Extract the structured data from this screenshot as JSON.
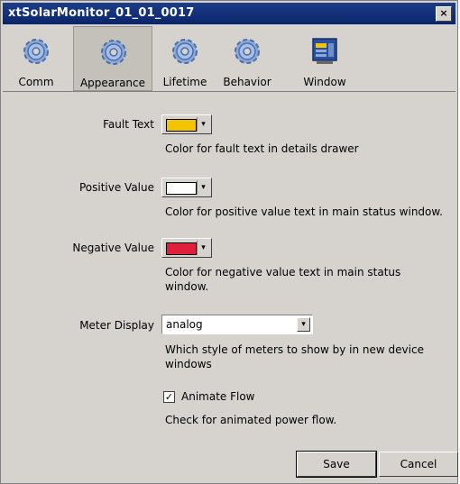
{
  "window": {
    "title": "xtSolarMonitor_01_01_0017",
    "close": "×"
  },
  "toolbar": {
    "items": [
      {
        "label": "Comm",
        "icon": "gear-icon"
      },
      {
        "label": "Appearance",
        "icon": "gear-icon",
        "selected": true
      },
      {
        "label": "Lifetime",
        "icon": "gear-icon"
      },
      {
        "label": "Behavior",
        "icon": "gear-icon"
      },
      {
        "label": "Window",
        "icon": "window-icon"
      }
    ]
  },
  "settings": {
    "fault_text": {
      "label": "Fault Text",
      "color": "#f5c400",
      "description": "Color for fault text in details drawer"
    },
    "positive_value": {
      "label": "Positive Value",
      "color": "#ffffff",
      "description": "Color for positive value text in main status window."
    },
    "negative_value": {
      "label": "Negative Value",
      "color": "#e0203a",
      "description": "Color for negative value text in main status window."
    },
    "meter_display": {
      "label": "Meter Display",
      "value": "analog",
      "description": "Which style of meters to show by in new device windows"
    },
    "animate_flow": {
      "label": "Animate Flow",
      "checked": true,
      "description": "Check for animated power flow."
    }
  },
  "buttons": {
    "save": "Save",
    "cancel": "Cancel"
  },
  "colors": {
    "titlebar": "#0a246a",
    "panel": "#d6d3ce"
  }
}
